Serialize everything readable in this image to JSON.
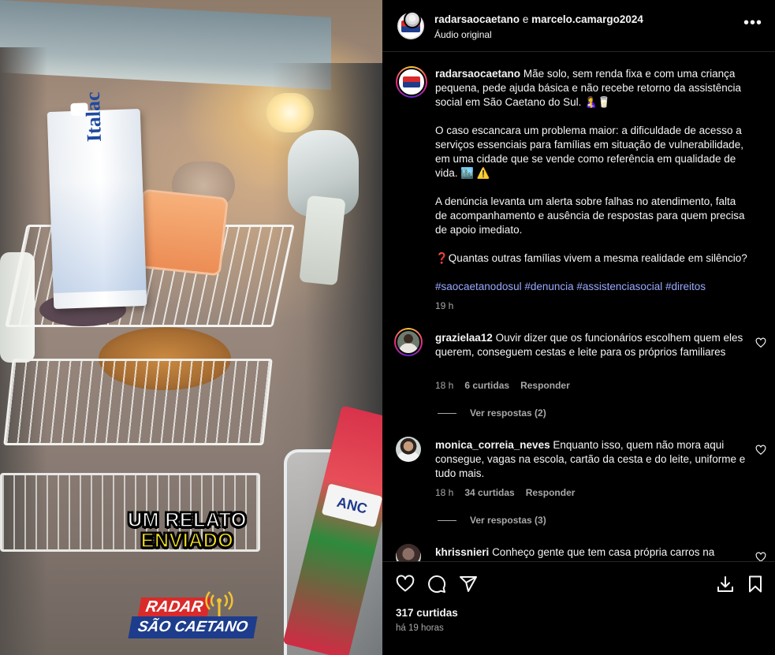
{
  "video": {
    "overlay_line1": "UM RELATO",
    "overlay_line2": "ENVIADO",
    "logo_top": "RADAR",
    "logo_bottom": "SÃO CAETANO",
    "carton_brand": "Italac"
  },
  "header": {
    "author1": "radarsaocaetano",
    "joiner": " e ",
    "author2": "marcelo.camargo2024",
    "audio": "Áudio original",
    "more_icon": "more-horizontal-icon"
  },
  "caption": {
    "username": "radarsaocaetano",
    "paragraph1": "Mãe solo, sem renda fixa e com uma criança pequena, pede ajuda básica e não recebe retorno da assistência social em São Caetano do Sul. 🤱🥛",
    "paragraph2": "O caso escancara um problema maior: a dificuldade de acesso a serviços essenciais para famílias em situação de vulnerabilidade, em uma cidade que se vende como referência em qualidade de vida. 🏙️ ⚠️",
    "paragraph3": "A denúncia levanta um alerta sobre falhas no atendimento, falta de acompanhamento e ausência de respostas para quem precisa de apoio imediato.",
    "paragraph4": "❓Quantas outras famílias vivem a mesma realidade em silêncio?",
    "hashtags": "#saocaetanodosul #denuncia #assistenciasocial #direitos",
    "time": "19 h"
  },
  "comments": [
    {
      "username": "grazielaa12",
      "text": "Ouvir dizer que os funcionários escolhem quem eles querem, conseguem cestas e leite para os próprios familiares",
      "time": "18 h",
      "likes": "6 curtidas",
      "reply": "Responder",
      "view_replies": "Ver respostas (2)"
    },
    {
      "username": "monica_correia_neves",
      "text": "Enquanto isso, quem não mora aqui consegue, vagas na escola, cartão da cesta e do leite, uniforme e tudo mais.",
      "time": "18 h",
      "likes": "34 curtidas",
      "reply": "Responder",
      "view_replies": "Ver respostas (3)"
    },
    {
      "username": "khrissnieri",
      "text": "Conheço gente que tem casa própria carros na"
    }
  ],
  "actions": {
    "like_icon": "heart-icon",
    "comment_icon": "comment-icon",
    "share_icon": "share-icon",
    "save_icon": "bookmark-icon",
    "download_icon": "download-icon",
    "likes": "317 curtidas",
    "posted": "há 19 horas"
  },
  "colors": {
    "background": "#000000",
    "text": "#f5f5f5",
    "secondary": "#a8a8a8",
    "hashtag": "#99a9ff",
    "divider": "#262626"
  }
}
